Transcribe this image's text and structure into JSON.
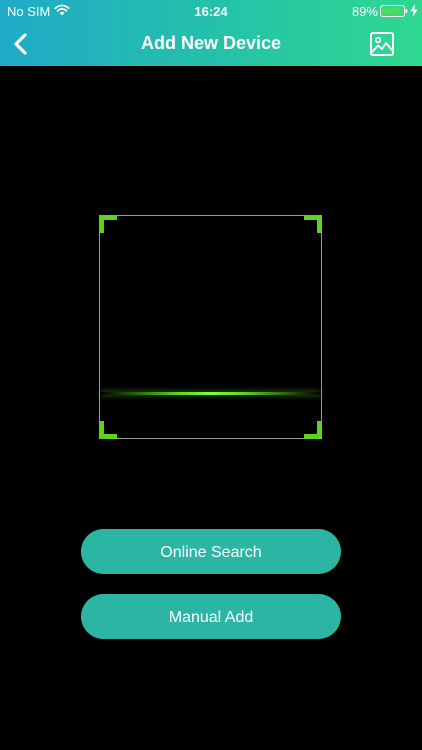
{
  "status_bar": {
    "carrier": "No SIM",
    "time": "16:24",
    "battery_percent": "89%",
    "battery_level": 0.89,
    "battery_color": "#4cd964"
  },
  "nav": {
    "title": "Add New Device",
    "back_icon": "chevron-left-icon",
    "gallery_icon": "image-icon"
  },
  "scanner": {
    "accent_color": "#5fd321"
  },
  "actions": {
    "online_search_label": "Online Search",
    "manual_add_label": "Manual Add",
    "button_color": "#2db5a4"
  },
  "theme": {
    "header_gradient_start": "#1faac8",
    "header_gradient_end": "#2fd88f"
  }
}
